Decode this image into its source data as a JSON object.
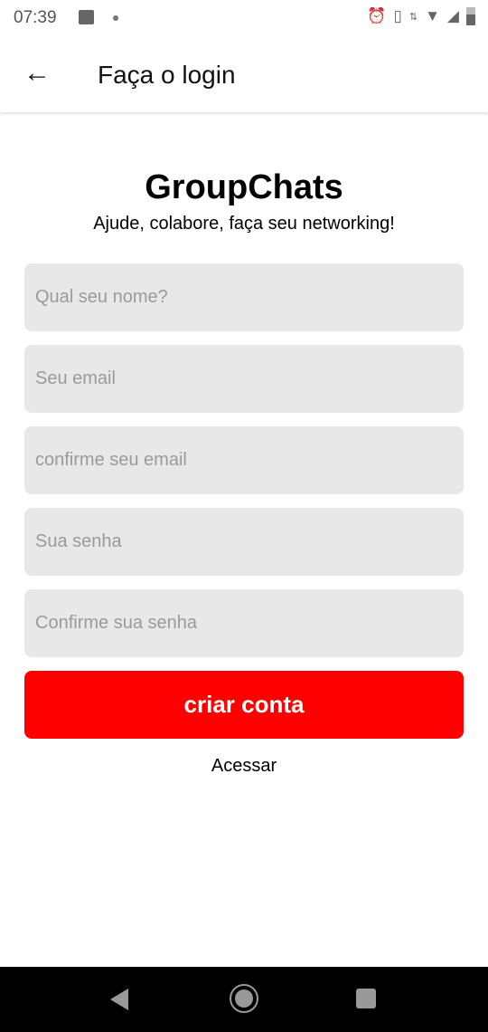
{
  "status_bar": {
    "time": "07:39",
    "icons": [
      "image-icon",
      "dot-icon",
      "alarm-icon",
      "vibrate-icon",
      "data-arrows-icon",
      "wifi-icon",
      "signal-icon",
      "battery-icon"
    ]
  },
  "app_bar": {
    "title": "Faça o login",
    "back_icon": "arrow-left-icon"
  },
  "main": {
    "app_name": "GroupChats",
    "tagline": "Ajude, colabore, faça seu networking!",
    "fields": [
      {
        "placeholder": "Qual seu nome?",
        "value": ""
      },
      {
        "placeholder": "Seu email",
        "value": ""
      },
      {
        "placeholder": "confirme seu email",
        "value": ""
      },
      {
        "placeholder": "Sua senha",
        "value": ""
      },
      {
        "placeholder": "Confirme sua senha",
        "value": ""
      }
    ],
    "submit_label": "criar conta",
    "login_link": "Acessar"
  },
  "colors": {
    "accent": "#ff0000",
    "field_bg": "#e8e8e8"
  }
}
